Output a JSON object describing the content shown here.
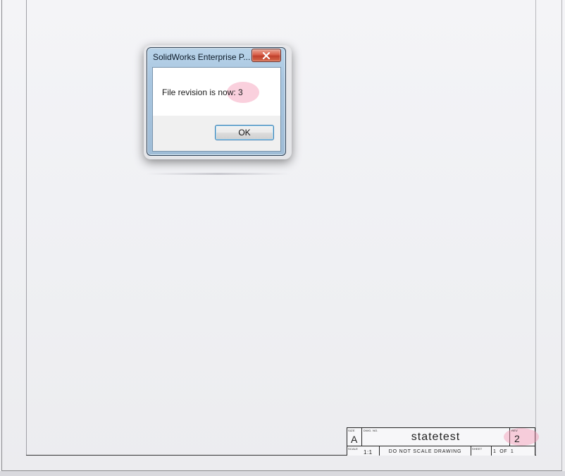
{
  "dialog": {
    "title": "SolidWorks Enterprise P...",
    "message_prefix": "File revision is now: ",
    "revision_value": "3",
    "ok_label": "OK"
  },
  "title_block": {
    "size_label": "SIZE",
    "size_value": "A",
    "dwg_no_label": "DWG. NO.",
    "dwg_no_value": "statetest",
    "rev_label": "REV",
    "rev_value": "2",
    "scale_label": "SCALE",
    "scale_value": "1:1",
    "note": "DO NOT SCALE DRAWING",
    "sheet_label": "SHEET",
    "sheet_value": "1  OF  1"
  },
  "colors": {
    "highlight": "#f496b4",
    "dialog_frame": "#a9c6e0",
    "close_button": "#c0402c"
  }
}
